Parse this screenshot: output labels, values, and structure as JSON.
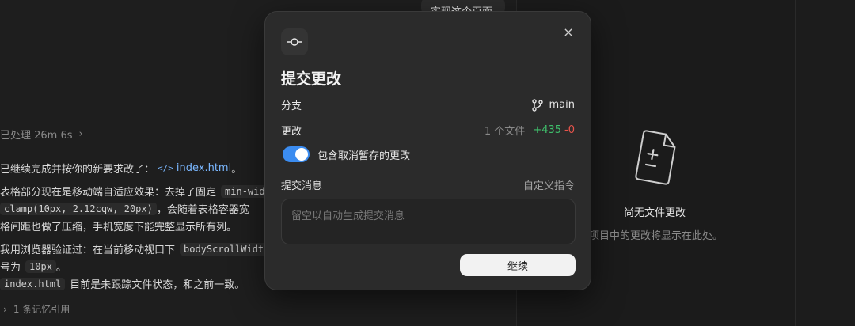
{
  "background": {
    "top_pill": "实现这个页面",
    "processed": "已处理 26m 6s",
    "processed_chevron": "›",
    "message": {
      "line1_text": "已继续完成并按你的新要求改了：",
      "line1_link_icon": "</>",
      "line1_link": "index.html",
      "line1_tail": "。",
      "line2_text": "表格部分现在是移动端自适应效果：去掉了固定",
      "line2_code": "min-width",
      "line3_code": "clamp(10px, 2.12cqw, 20px)",
      "line3_text": "，会随着表格容器宽",
      "line4_text": "格间距也做了压缩，手机宽度下能完整显示所有列。",
      "line5_text": "我用浏览器验证过：在当前移动视口下",
      "line5_code": "bodyScrollWidth",
      "line6_text": "号为",
      "line6_code": "10px",
      "line6_tail": "。",
      "line7_code": "index.html",
      "line7_text": "目前是未跟踪文件状态，和之前一致。"
    },
    "memory_ref": "1 条记忆引用",
    "memory_chevron": "›",
    "empty_state": {
      "title": "尚无文件更改",
      "description": "项目中的更改将显示在此处。"
    }
  },
  "modal": {
    "title": "提交更改",
    "close_icon": "×",
    "branch_label": "分支",
    "branch_value": "main",
    "changes_label": "更改",
    "files_count": "1 个文件",
    "additions": "+435",
    "deletions": "-0",
    "toggle_label": "包含取消暂存的更改",
    "toggle_on": true,
    "commit_message_label": "提交消息",
    "custom_instructions_link": "自定义指令",
    "commit_message_value": "",
    "commit_message_placeholder": "留空以自动生成提交消息",
    "continue_label": "继续"
  },
  "colors": {
    "accent": "#3b8cf0",
    "additions": "#3fbf6b",
    "deletions": "#e5534b",
    "link": "#7ab7ff"
  }
}
